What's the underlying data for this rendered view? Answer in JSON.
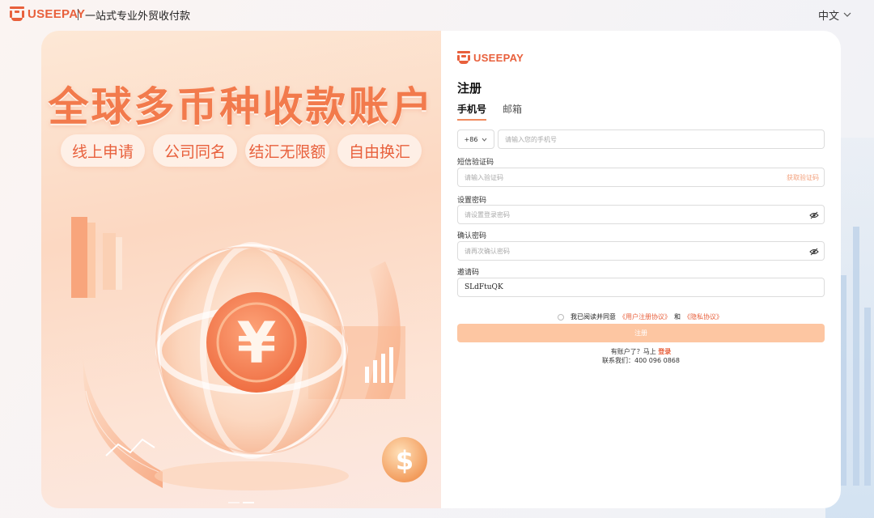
{
  "brand": {
    "logo_text": "USEEPAY",
    "slogan": "一站式专业外贸收付款",
    "accent_color": "#e8603c"
  },
  "header": {
    "language": "中文",
    "language_icon": "chevron-down-icon"
  },
  "hero": {
    "title": "全球多币种收款账户",
    "features": [
      "线上申请",
      "公司同名",
      "结汇无限额",
      "自由换汇"
    ]
  },
  "form": {
    "logo_text": "USEEPAY",
    "title": "注册",
    "tabs": [
      {
        "label": "手机号",
        "active": true
      },
      {
        "label": "邮箱",
        "active": false
      }
    ],
    "phone": {
      "country_code": "+86",
      "placeholder": "请输入您的手机号"
    },
    "sms": {
      "label": "短信验证码",
      "placeholder": "请输入验证码",
      "get_code": "获取验证码"
    },
    "password": {
      "label": "设置密码",
      "placeholder": "请设置登录密码"
    },
    "confirm": {
      "label": "确认密码",
      "placeholder": "请再次确认密码"
    },
    "invite": {
      "label": "邀请码",
      "value": "SLdFtuQK"
    },
    "agreement": {
      "prefix": "我已阅读并同意",
      "terms": "《用户注册协议》",
      "and": "和",
      "privacy": "《隐私协议》"
    },
    "submit_label": "注册",
    "have_account": "有账户了？马上",
    "login_label": "登录",
    "contact": "联系我们：400 096 0868"
  }
}
